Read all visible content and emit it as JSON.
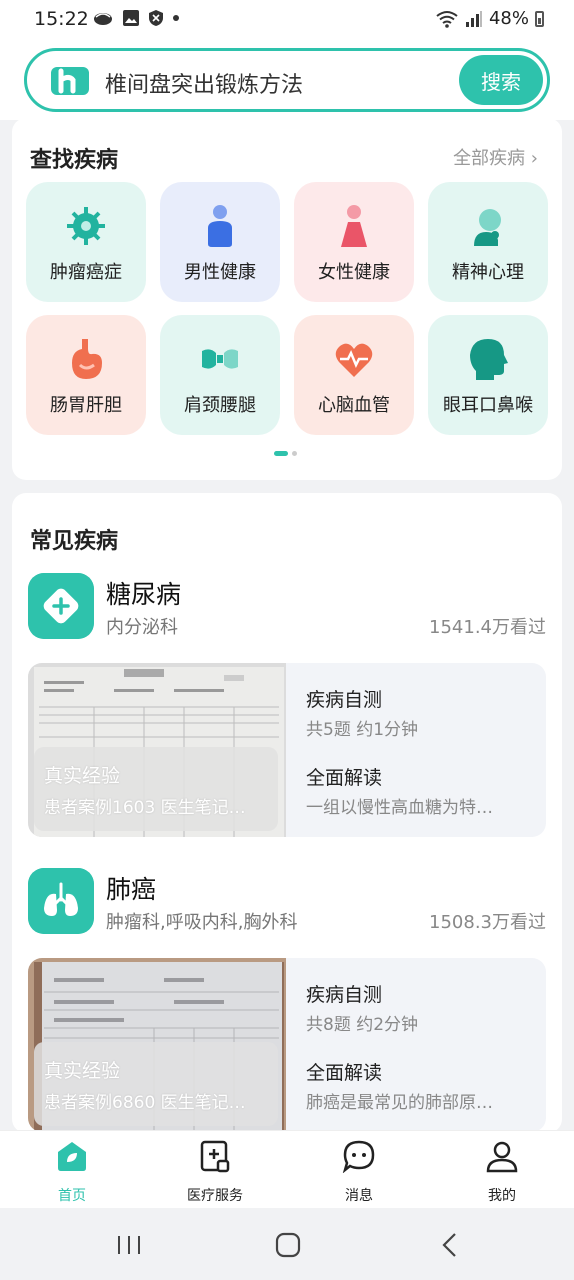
{
  "status": {
    "time": "15:22",
    "battery": "48%"
  },
  "search": {
    "query": "椎间盘突出锻炼方法",
    "button": "搜索"
  },
  "find": {
    "title": "查找疾病",
    "all": "全部疾病",
    "categories": [
      {
        "label": "肿瘤癌症",
        "icon": "tumor-icon"
      },
      {
        "label": "男性健康",
        "icon": "male-icon"
      },
      {
        "label": "女性健康",
        "icon": "female-icon"
      },
      {
        "label": "精神心理",
        "icon": "mental-icon"
      },
      {
        "label": "肠胃肝胆",
        "icon": "stomach-icon"
      },
      {
        "label": "肩颈腰腿",
        "icon": "joint-icon"
      },
      {
        "label": "心脑血管",
        "icon": "heart-icon"
      },
      {
        "label": "眼耳口鼻喉",
        "icon": "head-icon"
      }
    ]
  },
  "common": {
    "title": "常见疾病",
    "diseases": [
      {
        "name": "糖尿病",
        "dept": "内分泌科",
        "views": "1541.4万看过",
        "exp_title": "真实经验",
        "exp_sub": "患者案例1603 医生笔记…",
        "test_title": "疾病自测",
        "test_sub": "共5题 约1分钟",
        "read_title": "全面解读",
        "read_sub": "一组以慢性高血糖为特…"
      },
      {
        "name": "肺癌",
        "dept": "肿瘤科,呼吸内科,胸外科",
        "views": "1508.3万看过",
        "exp_title": "真实经验",
        "exp_sub": "患者案例6860 医生笔记…",
        "test_title": "疾病自测",
        "test_sub": "共8题 约2分钟",
        "read_title": "全面解读",
        "read_sub": "肺癌是最常见的肺部原…"
      }
    ]
  },
  "nav": {
    "items": [
      {
        "label": "首页",
        "active": true
      },
      {
        "label": "医疗服务"
      },
      {
        "label": "消息"
      },
      {
        "label": "我的"
      }
    ]
  },
  "colors": {
    "accent": "#2ec2ac"
  }
}
